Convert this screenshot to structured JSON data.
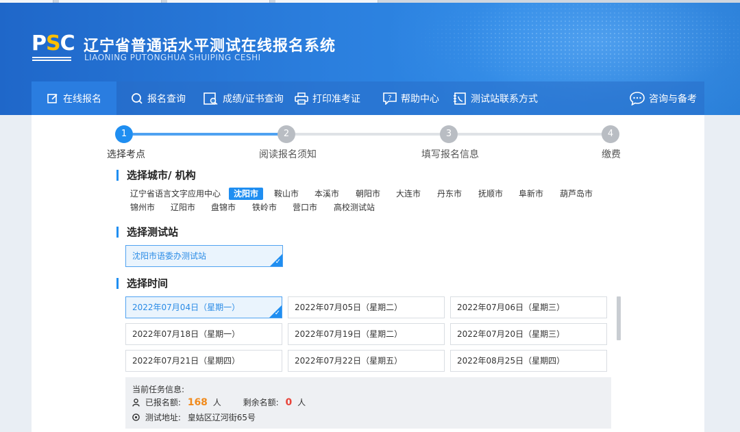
{
  "header": {
    "logo_text_p": "P",
    "logo_text_s": "S",
    "logo_text_c": "C",
    "title_cn": "辽宁省普通话水平测试在线报名系统",
    "title_en": "LIAONING PUTONGHUA SHUIPING CESHI"
  },
  "nav": {
    "items": [
      {
        "label": "在线报名",
        "icon": "edit-icon"
      },
      {
        "label": "报名查询",
        "icon": "search-icon"
      },
      {
        "label": "成绩/证书查询",
        "icon": "certificate-search-icon"
      },
      {
        "label": "打印准考证",
        "icon": "printer-icon"
      },
      {
        "label": "帮助中心",
        "icon": "help-icon"
      },
      {
        "label": "测试站联系方式",
        "icon": "contact-icon"
      },
      {
        "label": "咨询与备考",
        "icon": "chat-icon"
      }
    ],
    "active_index": 0
  },
  "steps": [
    {
      "num": "1",
      "label": "选择考点",
      "state": "active"
    },
    {
      "num": "2",
      "label": "阅读报名须知",
      "state": "todo"
    },
    {
      "num": "3",
      "label": "填写报名信息",
      "state": "todo"
    },
    {
      "num": "4",
      "label": "缴费",
      "state": "todo"
    }
  ],
  "section_city": {
    "title": "选择城市/ 机构",
    "cities_row1": [
      "辽宁省语言文字应用中心",
      "沈阳市",
      "鞍山市",
      "本溪市",
      "朝阳市",
      "大连市",
      "丹东市",
      "抚顺市",
      "阜新市",
      "葫芦岛市"
    ],
    "cities_row2": [
      "锦州市",
      "辽阳市",
      "盘锦市",
      "铁岭市",
      "营口市",
      "高校测试站"
    ],
    "selected": "沈阳市"
  },
  "section_station": {
    "title": "选择测试站",
    "selected_station": "沈阳市语委办测试站"
  },
  "section_time": {
    "title": "选择时间",
    "dates": [
      "2022年07月04日（星期一）",
      "2022年07月05日（星期二）",
      "2022年07月06日（星期三）",
      "2022年07月18日（星期一）",
      "2022年07月19日（星期二）",
      "2022年07月20日（星期三）",
      "2022年07月21日（星期四）",
      "2022年07月22日（星期五）",
      "2022年08月25日（星期四）"
    ],
    "selected_index": 0
  },
  "task_info": {
    "heading": "当前任务信息:",
    "registered_label": "已报名额:",
    "registered_value": "168",
    "registered_unit": "人",
    "remaining_label": "剩余名额:",
    "remaining_value": "0",
    "remaining_unit": "人",
    "address_label": "测试地址:",
    "address_value": "皇姑区辽河街65号"
  },
  "colors": {
    "primary": "#1f8ef1",
    "banner": "#2b7fde",
    "registered": "#f08a1c",
    "remaining": "#e8443a"
  }
}
